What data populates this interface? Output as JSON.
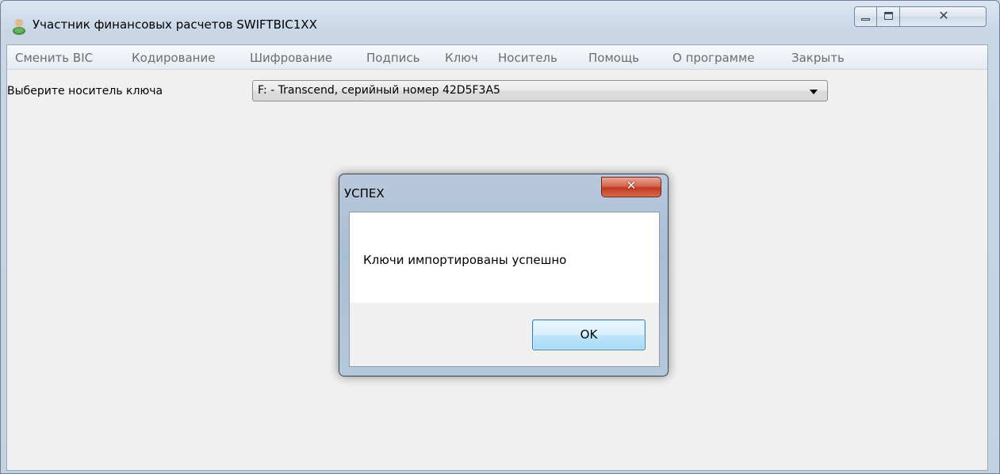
{
  "window": {
    "title": "Участник финансовых расчетов SWIFTBIC1XX",
    "icon": "user-icon"
  },
  "menu": [
    {
      "label": "Сменить BIC"
    },
    {
      "label": "Кодирование"
    },
    {
      "label": "Шифрование"
    },
    {
      "label": "Подпись"
    },
    {
      "label": "Ключ"
    },
    {
      "label": "Носитель"
    },
    {
      "label": "Помощь"
    },
    {
      "label": "О программе"
    },
    {
      "label": "Закрыть"
    }
  ],
  "media": {
    "label": "Выберите носитель ключа",
    "selected": "F: - Transcend, серийный номер 42D5F3A5"
  },
  "dialog": {
    "title": "УСПЕХ",
    "message": "Ключи импортированы успешно",
    "ok_label": "OK"
  },
  "colors": {
    "dialog_close": "#c0391f",
    "ok_border": "#3c7fb1"
  }
}
